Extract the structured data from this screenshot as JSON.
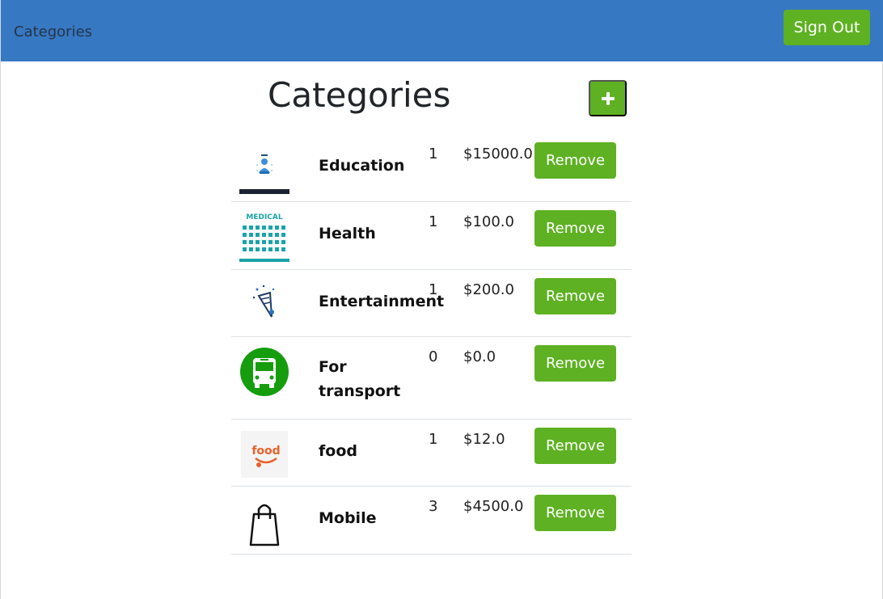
{
  "navbar": {
    "brand": "Categories",
    "signout_label": "Sign Out",
    "color": "#3778c2"
  },
  "page": {
    "title": "Categories",
    "add_icon": "plus-icon"
  },
  "accent_color": "#5eb122",
  "categories": [
    {
      "name": "Education",
      "count": "1",
      "amount": "$15000.0",
      "remove_label": "Remove",
      "icon": "education-icon"
    },
    {
      "name": "Health",
      "count": "1",
      "amount": "$100.0",
      "remove_label": "Remove",
      "icon": "medical-icon",
      "icon_text": "MEDICAL"
    },
    {
      "name": "Entertainment",
      "count": "1",
      "amount": "$200.0",
      "remove_label": "Remove",
      "icon": "party-popper-icon"
    },
    {
      "name": "For transport",
      "count": "0",
      "amount": "$0.0",
      "remove_label": "Remove",
      "icon": "bus-icon"
    },
    {
      "name": "food",
      "count": "1",
      "amount": "$12.0",
      "remove_label": "Remove",
      "icon": "food-logo-icon",
      "icon_text": "food"
    },
    {
      "name": "Mobile",
      "count": "3",
      "amount": "$4500.0",
      "remove_label": "Remove",
      "icon": "shopping-bag-icon"
    }
  ]
}
